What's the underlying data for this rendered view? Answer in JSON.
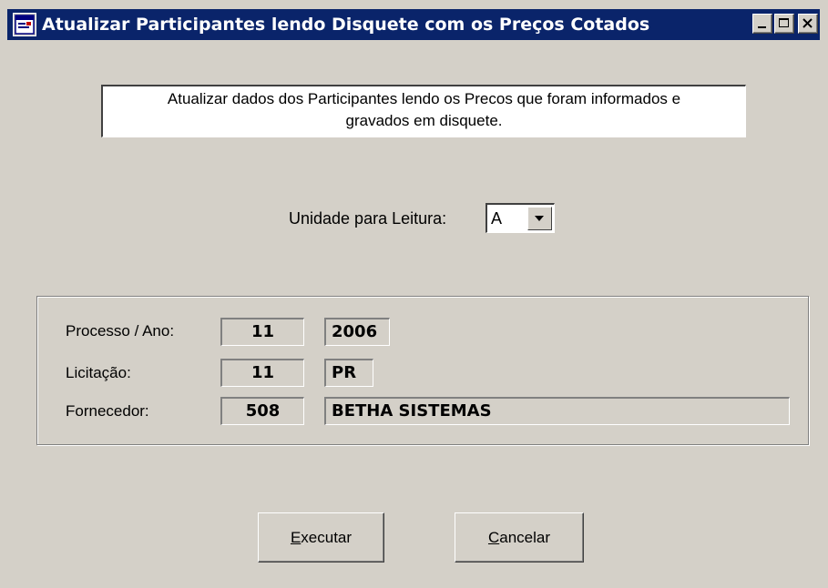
{
  "window": {
    "title": "Atualizar Participantes lendo Disquete com os Preços Cotados",
    "icon": "app-window-icon",
    "colors": {
      "titlebar": "#0a246a",
      "face": "#d4d0c8"
    }
  },
  "description": {
    "line1": "Atualizar dados dos Participantes lendo os Precos que foram informados e",
    "line2": "gravados em disquete."
  },
  "unit": {
    "label": "Unidade para Leitura:",
    "selected": "A"
  },
  "details": {
    "processo": {
      "label": "Processo / Ano:",
      "number": "11",
      "year": "2006"
    },
    "licitacao": {
      "label": "Licitação:",
      "number": "11",
      "type": "PR"
    },
    "fornecedor": {
      "label": "Fornecedor:",
      "code": "508",
      "name": "BETHA SISTEMAS"
    }
  },
  "buttons": {
    "execute": {
      "mnemonic": "E",
      "rest": "xecutar"
    },
    "cancel": {
      "mnemonic": "C",
      "rest": "ancelar"
    }
  }
}
